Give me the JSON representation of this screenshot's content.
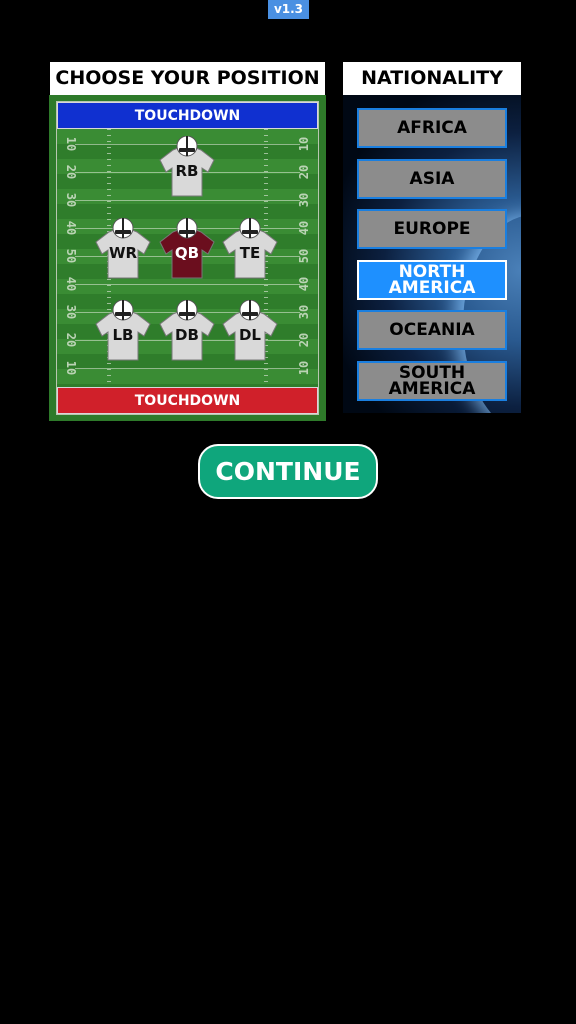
{
  "version": "v1.3",
  "position_panel": {
    "title": "CHOOSE YOUR POSITION",
    "endzone_top": "TOUCHDOWN",
    "endzone_bottom": "TOUCHDOWN",
    "yard_numbers": [
      "10",
      "20",
      "30",
      "40",
      "50",
      "40",
      "30",
      "20",
      "10"
    ],
    "positions": [
      {
        "label": "RB",
        "selected": false
      },
      {
        "label": "WR",
        "selected": false
      },
      {
        "label": "QB",
        "selected": true
      },
      {
        "label": "TE",
        "selected": false
      },
      {
        "label": "LB",
        "selected": false
      },
      {
        "label": "DB",
        "selected": false
      },
      {
        "label": "DL",
        "selected": false
      }
    ]
  },
  "nationality_panel": {
    "title": "NATIONALITY",
    "options": [
      {
        "label": "AFRICA",
        "selected": false
      },
      {
        "label": "ASIA",
        "selected": false
      },
      {
        "label": "EUROPE",
        "selected": false
      },
      {
        "label": "NORTH AMERICA",
        "selected": true
      },
      {
        "label": "OCEANIA",
        "selected": false
      },
      {
        "label": "SOUTH AMERICA",
        "selected": false
      }
    ]
  },
  "continue_label": "CONTINUE",
  "colors": {
    "jersey": "#d9d9d9",
    "jersey_selected": "#6b0e1e",
    "nat_selected": "#1e90ff",
    "continue": "#0fa67c"
  }
}
